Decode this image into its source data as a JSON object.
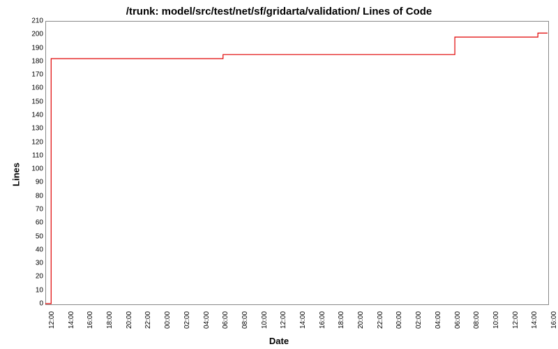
{
  "chart_data": {
    "type": "line",
    "title": "/trunk: model/src/test/net/sf/gridarta/validation/ Lines of Code",
    "xlabel": "Date",
    "ylabel": "Lines",
    "ylim": [
      0,
      210
    ],
    "yticks": [
      0,
      10,
      20,
      30,
      40,
      50,
      60,
      70,
      80,
      90,
      100,
      110,
      120,
      130,
      140,
      150,
      160,
      170,
      180,
      190,
      200,
      210
    ],
    "xticks": [
      "12:00",
      "14:00",
      "16:00",
      "18:00",
      "20:00",
      "22:00",
      "00:00",
      "02:00",
      "04:00",
      "06:00",
      "08:00",
      "10:00",
      "12:00",
      "14:00",
      "16:00",
      "18:00",
      "20:00",
      "22:00",
      "00:00",
      "02:00",
      "04:00",
      "06:00",
      "08:00",
      "10:00",
      "12:00",
      "14:00",
      "16:00"
    ],
    "series": [
      {
        "name": "Lines of Code",
        "color": "#e00000",
        "x": [
          0,
          0.3,
          0.3,
          9.2,
          9.2,
          21.2,
          21.2,
          25.5,
          25.5,
          26
        ],
        "y": [
          0,
          0,
          182,
          182,
          185,
          185,
          198,
          198,
          201,
          201
        ]
      }
    ],
    "x_range": [
      0,
      26
    ]
  }
}
